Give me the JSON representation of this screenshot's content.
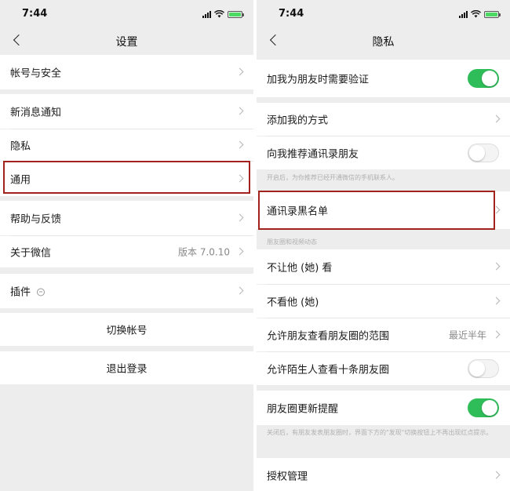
{
  "left": {
    "status_time": "7:44",
    "title": "设置",
    "items": [
      {
        "label": "帐号与安全"
      },
      {
        "label": "新消息通知"
      },
      {
        "label": "隐私"
      },
      {
        "label": "通用"
      },
      {
        "label": "帮助与反馈"
      },
      {
        "label": "关于微信",
        "value": "版本 7.0.10"
      },
      {
        "label": "插件"
      }
    ],
    "switch_account": "切换帐号",
    "logout": "退出登录"
  },
  "right": {
    "status_time": "7:44",
    "title": "隐私",
    "verify_label": "加我为朋友时需要验证",
    "verify_on": true,
    "add_me_label": "添加我的方式",
    "recommend_label": "向我推荐通讯录朋友",
    "recommend_on": false,
    "recommend_note": "开启后，为你推荐已经开通微信的手机联系人。",
    "blacklist_label": "通讯录黑名单",
    "moments_section": "朋友圈和视频动态",
    "moments_items": [
      {
        "label": "不让他 (她) 看"
      },
      {
        "label": "不看他 (她)"
      },
      {
        "label": "允许朋友查看朋友圈的范围",
        "value": "最近半年"
      }
    ],
    "stranger_label": "允许陌生人查看十条朋友圈",
    "stranger_on": false,
    "update_label": "朋友圈更新提醒",
    "update_on": true,
    "update_note": "关闭后，有朋友发表朋友圈时，界面下方的\"发现\"切换按钮上不再出现红点提示。",
    "auth_label": "授权管理"
  },
  "colors": {
    "toggle_on": "#2fbd59",
    "highlight": "#a0231d",
    "background": "#ededed"
  }
}
